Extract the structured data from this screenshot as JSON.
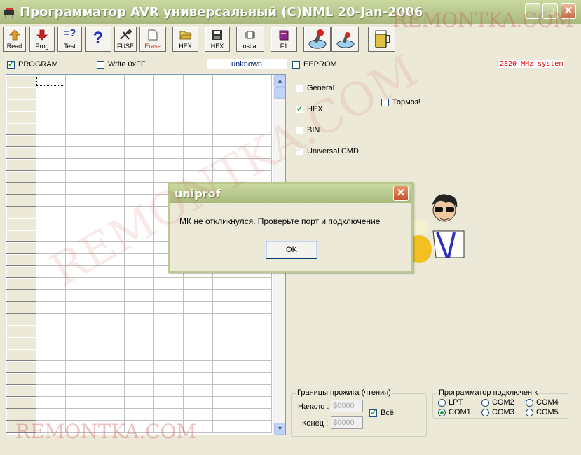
{
  "window": {
    "title": "Программатор AVR универсальный (С)NML 20-Jan-2006",
    "controls": {
      "minimize": "_",
      "maximize": "□",
      "close": "✕"
    }
  },
  "toolbar": {
    "buttons": [
      {
        "label": "Read",
        "icon": "arrow-up-icon",
        "color": "#e89a1e"
      },
      {
        "label": "Prog",
        "icon": "arrow-down-icon",
        "color": "#d62020"
      },
      {
        "label": "Test",
        "icon": "compare-icon",
        "color": "#2030c0"
      },
      {
        "label": "",
        "icon": "help-icon",
        "color": "#2030c0"
      },
      {
        "label": "FUSE",
        "icon": "tools-icon",
        "color": "#333333"
      },
      {
        "label": "Erase",
        "icon": "page-icon",
        "color": "#d62020"
      },
      {
        "label": "HEX",
        "icon": "open-folder-icon",
        "color": "#d8b23a"
      },
      {
        "label": "HEX",
        "icon": "save-disk-icon",
        "color": "#333333"
      },
      {
        "label": "oscal",
        "icon": "chip-icon",
        "color": "#333333"
      },
      {
        "label": "F1",
        "icon": "book-icon",
        "color": "#8a2a8a"
      },
      {
        "label": "",
        "icon": "stamp-red-icon",
        "color": "#d62020"
      },
      {
        "label": "",
        "icon": "stamp-icon",
        "color": "#c03030"
      },
      {
        "label": "",
        "icon": "beer-mug-icon",
        "color": "#e0c040"
      }
    ]
  },
  "options": {
    "program_label": "PROGRAM",
    "write_label": "Write 0xFF",
    "device": "unknown",
    "eeprom_label": "EEPROM",
    "clock": "2820 MHz system"
  },
  "formats": {
    "general": "General",
    "hex": "HEX",
    "bin": "BIN",
    "universal": "Universal CMD",
    "slow": "Тормоз!"
  },
  "bounds": {
    "title": "Границы прожига (чтения)",
    "start_label": "Начало :",
    "start_value": "$0000",
    "end_label": "Конец :",
    "end_value": "$0000",
    "all_label": "Всё!"
  },
  "port": {
    "title": "Программатор подключен к",
    "options": [
      "LPT",
      "COM2",
      "COM4",
      "COM1",
      "COM3",
      "COM5"
    ],
    "selected": "COM1"
  },
  "dialog": {
    "title": "uniprof",
    "message": "МК не откликнулся. Проверьте порт и подключение",
    "ok": "OK",
    "close": "✕"
  },
  "scroll": {
    "up": "▲",
    "down": "▼"
  },
  "watermark": "REMONTKA.COM"
}
